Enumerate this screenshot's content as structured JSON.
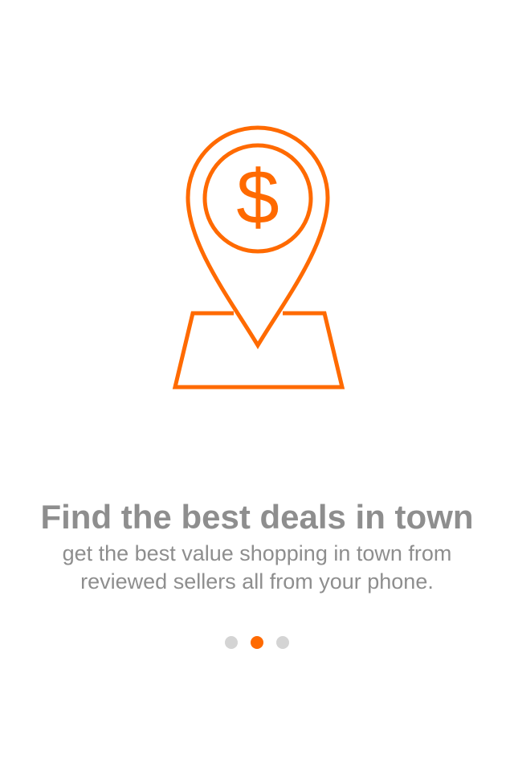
{
  "onboarding": {
    "illustration_icon": "map-pin-dollar-icon",
    "illustration_symbol": "$",
    "title": "Find the best deals in town",
    "subtitle": "get the best value shopping in town from reviewed sellers all from your phone."
  },
  "pager": {
    "total_pages": 3,
    "current_page": 2
  },
  "colors": {
    "accent": "#ff6a00",
    "text": "#8e8e8e",
    "dot_inactive": "#d4d4d4"
  }
}
